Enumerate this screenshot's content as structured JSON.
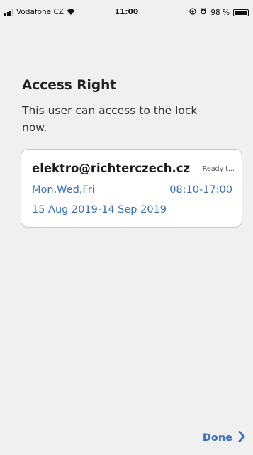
{
  "status_bar": {
    "carrier": "Vodafone CZ",
    "time": "11:00",
    "battery": "98 %",
    "battery_level": 0.98,
    "icons": [
      "signal-icon",
      "wifi-icon",
      "location-icon",
      "alarm-icon",
      "battery-icon"
    ]
  },
  "screen": {
    "title": "Access Right",
    "message": "This user can access to the lock now."
  },
  "access_card": {
    "email": "elektro@richterczech.cz",
    "status": "Ready t...",
    "days": "Mon,Wed,Fri",
    "time_range": "08:10-17:00",
    "date_range": "15 Aug 2019-14 Sep 2019"
  },
  "footer": {
    "done_label": "Done",
    "icon": "chevron-right-icon"
  },
  "colors": {
    "accent": "#3a6fc0",
    "background": "#f0f0f0"
  }
}
